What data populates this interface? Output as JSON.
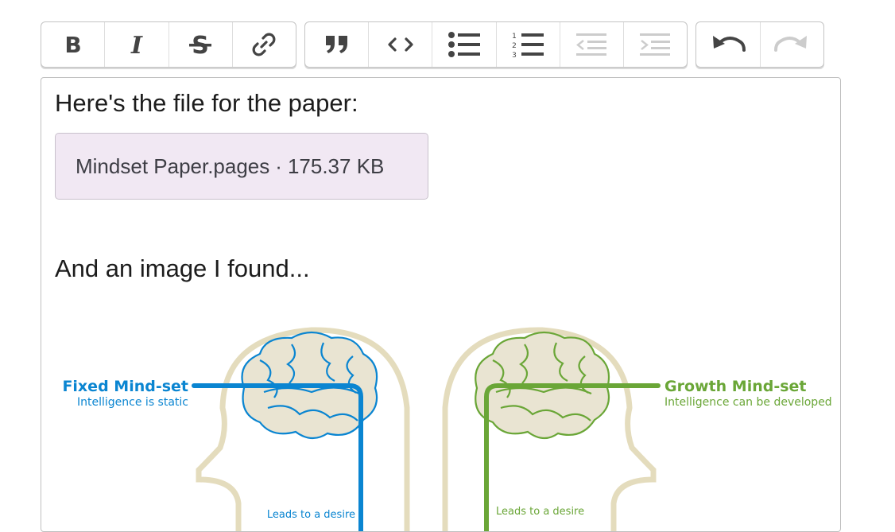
{
  "toolbar": {
    "groups": [
      {
        "buttons": [
          {
            "icon": "bold-icon",
            "label": "B"
          },
          {
            "icon": "italic-icon",
            "label": "I"
          },
          {
            "icon": "strikethrough-icon",
            "label": "S"
          },
          {
            "icon": "link-icon"
          }
        ]
      },
      {
        "buttons": [
          {
            "icon": "quote-icon"
          },
          {
            "icon": "code-icon"
          },
          {
            "icon": "bulleted-list-icon"
          },
          {
            "icon": "numbered-list-icon"
          },
          {
            "icon": "outdent-icon",
            "disabled": true
          },
          {
            "icon": "indent-icon",
            "disabled": true
          }
        ]
      },
      {
        "buttons": [
          {
            "icon": "undo-icon"
          },
          {
            "icon": "redo-icon",
            "disabled": true
          }
        ]
      }
    ],
    "icon_color": "#444444",
    "disabled_icon_color": "#cccccc"
  },
  "editor": {
    "paragraph_1": "Here's the file for the paper:",
    "attachment": {
      "filename": "Mindset Paper.pages",
      "separator": "·",
      "size": "175.37 KB",
      "background": "#f1e8f3"
    },
    "paragraph_2": "And an image I found...",
    "image": {
      "fixed": {
        "title": "Fixed Mind-set",
        "subtitle": "Intelligence is static",
        "caption": "Leads to a desire",
        "color": "#0a85d1"
      },
      "growth": {
        "title": "Growth Mind-set",
        "subtitle": "Intelligence can be developed",
        "caption": "Leads to a desire",
        "color": "#6aa637"
      },
      "head_color": "#e4dcbd"
    }
  }
}
